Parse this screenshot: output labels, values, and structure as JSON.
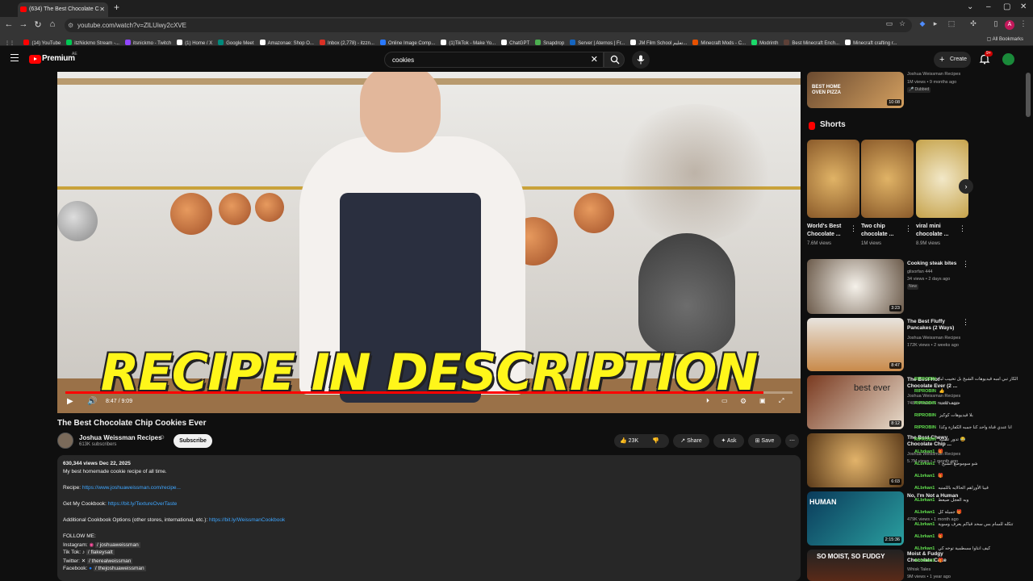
{
  "browser": {
    "tab_title": "(634) The Best Chocolate C",
    "url": "youtube.com/watch?v=ZlLUiwy2cXVE",
    "new_tab": "+",
    "bookmarks": [
      "(14) YouTube",
      "itzNickmo Stream -...",
      "itsnickmo - Twitch",
      "(1) Home / X",
      "Google Meet",
      "Amazonae: Shop O...",
      "Inbox (2,778) - itzzn...",
      "Online Image Comp...",
      "(1)TikTok - Make Yo...",
      "ChatGPT",
      "Snapdrop",
      "Server | Aternos | Fr...",
      "JM Film School تعليم...",
      "Minecraft Mods - C...",
      "Modrinth",
      "Best Minecraft Ench...",
      "Minecraft crafting r..."
    ],
    "all_bookmarks": "All Bookmarks",
    "bookmark_colors": [
      "#ff0000",
      "#00c853",
      "#9146ff",
      "#ffffff",
      "#00897b",
      "#ffffff",
      "#d93025",
      "#2979ff",
      "#ffffff",
      "#ffffff",
      "#4caf50",
      "#1565c0",
      "#ffffff",
      "#e65100",
      "#1bd96a",
      "#5d4037",
      "#ffffff"
    ]
  },
  "header": {
    "logo_text": "Premium",
    "country": "AE",
    "search_value": "cookies",
    "create_label": "Create",
    "notif_count": "9+"
  },
  "player": {
    "overlay_text": "RECIPE IN DESCRIPTION",
    "current_time": "8:47",
    "duration": "9:09",
    "progress": 0.96
  },
  "video": {
    "title": "The Best Chocolate Chip Cookies Ever",
    "channel": "Joshua Weissman Recipes",
    "subscribers": "613K subscribers",
    "subscribe_label": "Subscribe",
    "likes": "23K",
    "share_label": "Share",
    "ask_label": "Ask",
    "save_label": "Save"
  },
  "description": {
    "stats": "630,344 views  Dec 22, 2025",
    "line1": "My best homemade cookie recipe of all time.",
    "recipe_label": "Recipe: ",
    "recipe_link": "https://www.joshuaweissman.com/recipe...",
    "cookbook_label": "Get My Cookbook: ",
    "cookbook_link": "https://bit.ly/TextureOverTaste",
    "additional_label": "Additional Cookbook Options (other stores, international, etc.): ",
    "additional_link": "https://bit.ly/WeissmanCookbook",
    "follow": "FOLLOW ME:",
    "instagram_label": "Instagram:",
    "instagram": "/ joshuaweissman",
    "tiktok_label": "Tik Tok:",
    "tiktok": "/ flakeysalt",
    "twitter_label": "Twitter:",
    "twitter": "/ therealweissman",
    "facebook_label": "Facebook:",
    "facebook": "/ thejoshuaweissman"
  },
  "sidebar": {
    "top_item": {
      "channel": "Joshua Weissman Recipes",
      "meta": "1M views • 9 months ago",
      "badge": "Dubbed",
      "duration": "10:08",
      "thumb_text": "BEST HOME OVEN PIZZA"
    },
    "shorts_header": "Shorts",
    "shorts": [
      {
        "title": "World's Best Chocolate ...",
        "views": "7.6M views"
      },
      {
        "title": "Two chip chocolate ...",
        "views": "1M views"
      },
      {
        "title": "viral mini chocolate ...",
        "views": "8.9M views"
      }
    ],
    "items": [
      {
        "title": "Cooking steak bites",
        "channel": "glisorfan 444",
        "meta": "34 views • 2 days ago",
        "badge": "New",
        "duration": "3:23"
      },
      {
        "title": "The Best Fluffy Pancakes (2 Ways)",
        "channel": "Joshua Weissman Recipes",
        "meta": "172K views • 2 weeks ago",
        "duration": "8:47"
      },
      {
        "title": "The Best Hot Chocolate Ever (2 ...",
        "channel": "Joshua Weissman Recipes",
        "meta": "748K views • 1 month ago",
        "duration": "8:12",
        "thumb_text": "best ever"
      },
      {
        "title": "The Best Chewy Chocolate Chip ...",
        "channel": "Joshua Weissman Recipes",
        "meta": "5.7M views • 1 month ago",
        "duration": "6:03"
      },
      {
        "title": "No, I'm Not a Human",
        "channel": "",
        "meta": "479K views • 1 month ago",
        "duration": "2:15:36",
        "thumb_text": "HUMAN"
      },
      {
        "title": "Moist & Fudgy Chocolate Cake",
        "channel": "Whisk Tales",
        "meta": "9M views • 1 year ago",
        "duration": "",
        "thumb_text": "SO MOIST, SO FUDGY"
      }
    ]
  },
  "chat": [
    {
      "user": "RIPROBIN",
      "msg": "الكار تبي امبه قيديوهات الشيخ بل تخييب لبا"
    },
    {
      "user": "RIPROBIN",
      "msg": "👍"
    },
    {
      "user": "RIPROBIN",
      "msg": "حبيبت بلتب"
    },
    {
      "user": "RIPROBIN",
      "msg": "بلا قيديوهات كوكيز"
    },
    {
      "user": "RIPROBIN",
      "msg": "انا عندي قناة واحد كنا جمبه الكفازة وكذا"
    },
    {
      "user": "RIPROBIN",
      "msg": "تدور عسيه 😂"
    },
    {
      "user": "ALbrkan1",
      "msg": "🎁"
    },
    {
      "user": "ALbrkan1",
      "msg": "شو سوموضع الشيخ ؟"
    },
    {
      "user": "ALbrkan1",
      "msg": "🎁"
    },
    {
      "user": "ALbrkan1",
      "msg": "قيبا الأوراهم الحالايه باللمنيه"
    },
    {
      "user": "ALbrkan1",
      "msg": "وبه العجل ضيعط"
    },
    {
      "user": "ALbrkan1",
      "msg": "جميلة كل 🎁"
    },
    {
      "user": "ALbrkan1",
      "msg": "تتكله للسام بس سحد قباكم يعرف وسوية"
    },
    {
      "user": "ALbrkan1",
      "msg": "🎁"
    },
    {
      "user": "ALbrkan1",
      "msg": "كيف انتاوا مسطمية توخه كي"
    },
    {
      "user": "ALbrkan1",
      "msg": "🎁"
    }
  ]
}
